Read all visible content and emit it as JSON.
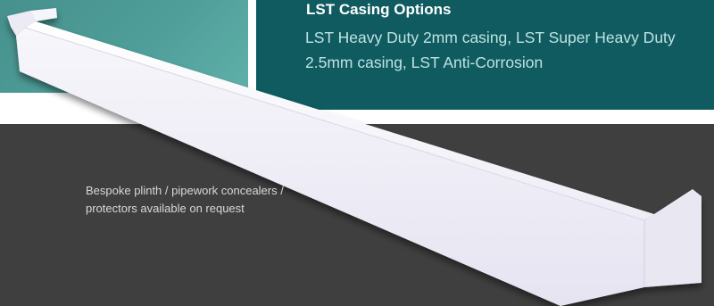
{
  "casing_options": {
    "title": "LST Casing Options",
    "description": "LST Heavy Duty 2mm casing, LST Super Heavy Duty 2.5mm casing, LST Anti-Corrosion"
  },
  "plinth": {
    "text": "Bespoke plinth / pipework concealers / protectors available on request"
  },
  "colors": {
    "teal_light": "#4f9e99",
    "teal_dark": "#0f5b60",
    "band_grey": "#3f3f40",
    "casing_white": "#f3f2fa"
  }
}
